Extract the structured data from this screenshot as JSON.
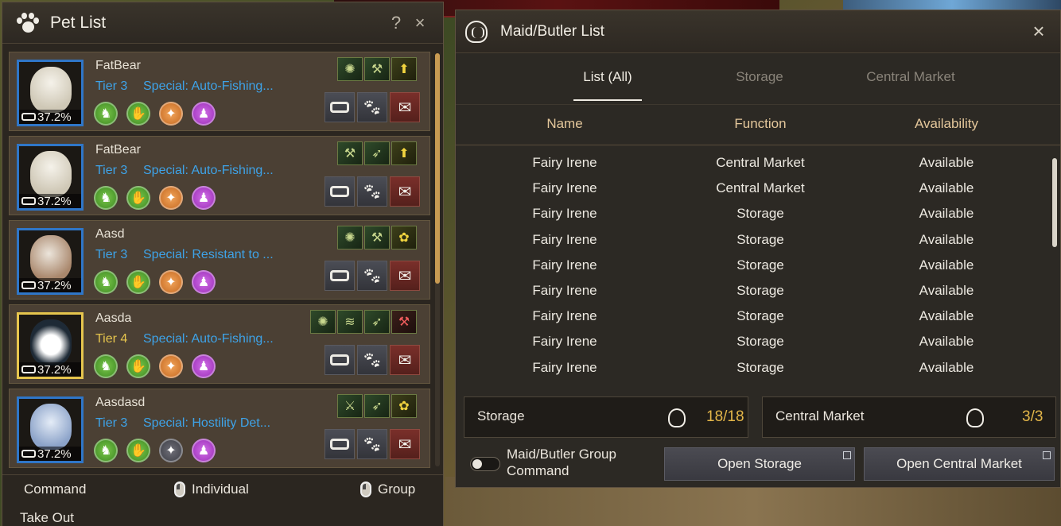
{
  "pet_window": {
    "title": "Pet List",
    "help_label": "?",
    "close_label": "×",
    "pets": [
      {
        "name": "FatBear",
        "tier_label": "Tier 3",
        "tier_color": "#3ea3e8",
        "special": "Special: Auto-Fishing...",
        "hunger": "37.2%",
        "animal": "bear",
        "frame": "blue",
        "skills": [
          "green",
          "green",
          "orange",
          "purple"
        ],
        "talents": [
          "scorpion-icon",
          "pickaxe-icon",
          "level-up-icon"
        ]
      },
      {
        "name": "FatBear",
        "tier_label": "Tier 3",
        "tier_color": "#3ea3e8",
        "special": "Special: Auto-Fishing...",
        "hunger": "37.2%",
        "animal": "bear",
        "frame": "blue",
        "skills": [
          "green",
          "green",
          "orange",
          "purple"
        ],
        "talents": [
          "pickaxe-icon",
          "wing-icon",
          "level-up-icon"
        ]
      },
      {
        "name": "Aasd",
        "tier_label": "Tier 3",
        "tier_color": "#3ea3e8",
        "special": "Special: Resistant to ...",
        "hunger": "37.2%",
        "animal": "fox",
        "frame": "blue",
        "skills": [
          "green",
          "green",
          "orange",
          "purple"
        ],
        "talents": [
          "scorpion-icon",
          "pickaxe-icon",
          "gather-icon"
        ]
      },
      {
        "name": "Aasda",
        "tier_label": "Tier 4",
        "tier_color": "#e6c54d",
        "special": "Special: Auto-Fishing...",
        "hunger": "37.2%",
        "animal": "penguin",
        "frame": "gold",
        "skills": [
          "green",
          "green",
          "orange",
          "purple"
        ],
        "talents": [
          "scorpion-icon",
          "wave-icon",
          "wing-icon",
          "pickaxe-red-icon"
        ]
      },
      {
        "name": "Aasdasd",
        "tier_label": "Tier 3",
        "tier_color": "#3ea3e8",
        "special": "Special: Hostility Det...",
        "hunger": "37.2%",
        "animal": "wolf",
        "frame": "blue",
        "skills": [
          "green",
          "green",
          "grey",
          "purple"
        ],
        "talents": [
          "axe-icon",
          "wing-icon",
          "gather-icon"
        ]
      }
    ],
    "footer": {
      "command": "Command",
      "individual": "Individual",
      "group": "Group",
      "take_out": "Take Out"
    }
  },
  "maid_window": {
    "title": "Maid/Butler List",
    "close_label": "×",
    "tabs": [
      "List (All)",
      "Storage",
      "Central Market"
    ],
    "active_tab": 0,
    "columns": [
      "Name",
      "Function",
      "Availability"
    ],
    "rows": [
      [
        "Fairy Irene",
        "Central Market",
        "Available"
      ],
      [
        "Fairy Irene",
        "Central Market",
        "Available"
      ],
      [
        "Fairy Irene",
        "Storage",
        "Available"
      ],
      [
        "Fairy Irene",
        "Storage",
        "Available"
      ],
      [
        "Fairy Irene",
        "Storage",
        "Available"
      ],
      [
        "Fairy Irene",
        "Storage",
        "Available"
      ],
      [
        "Fairy Irene",
        "Storage",
        "Available"
      ],
      [
        "Fairy Irene",
        "Storage",
        "Available"
      ],
      [
        "Fairy Irene",
        "Storage",
        "Available"
      ]
    ],
    "storage_label": "Storage",
    "storage_count": "18/18",
    "market_label": "Central Market",
    "market_count": "3/3",
    "group_command_label": "Maid/Butler Group Command",
    "open_storage": "Open Storage",
    "open_market": "Open Central Market"
  },
  "colors": {
    "accent_gold": "#e3b649",
    "tier_blue": "#3ea3e8",
    "header_gold": "#e4c79b"
  }
}
